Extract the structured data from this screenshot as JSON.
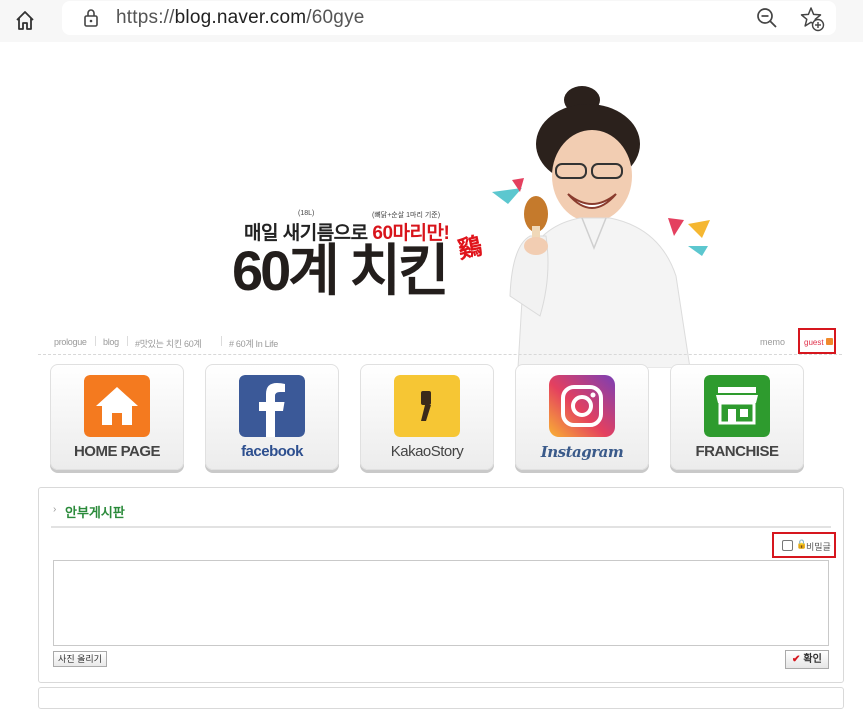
{
  "browser": {
    "url_prefix": "https://",
    "url_host": "blog.naver.com",
    "url_path": "/60gye"
  },
  "banner": {
    "subtitle_prefix": "매일 새기름으로 ",
    "subtitle_highlight": "60마리만!",
    "tiny_note_1": "(18L)",
    "tiny_note_2": "(뼈닭+순살 1마리 기준)",
    "title": "60계 치킨",
    "stamp": "鷄"
  },
  "blognav": {
    "items": [
      "prologue",
      "blog",
      "#맛있는 치킨 60계",
      "# 60계 In Life"
    ],
    "memo": "memo",
    "guest": "guest"
  },
  "tiles": [
    {
      "label": "HOME PAGE",
      "icon": "home-icon",
      "color": "#f47a1f"
    },
    {
      "label": "facebook",
      "icon": "facebook-icon",
      "color": "#3b5998"
    },
    {
      "label": "KakaoStory",
      "icon": "kakaostory-icon",
      "color": "#f6c634"
    },
    {
      "label": "Instagram",
      "icon": "instagram-icon",
      "color": "#c13584"
    },
    {
      "label": "FRANCHISE",
      "icon": "franchise-icon",
      "color": "#2e9b2e"
    }
  ],
  "guestbook": {
    "title": "안부게시판",
    "secret_label": "비밀글",
    "photo_button": "사진 올리기",
    "ok_button": "확인"
  },
  "colors": {
    "highlight_box": "#d6161e",
    "title_green": "#2a8a3a"
  }
}
